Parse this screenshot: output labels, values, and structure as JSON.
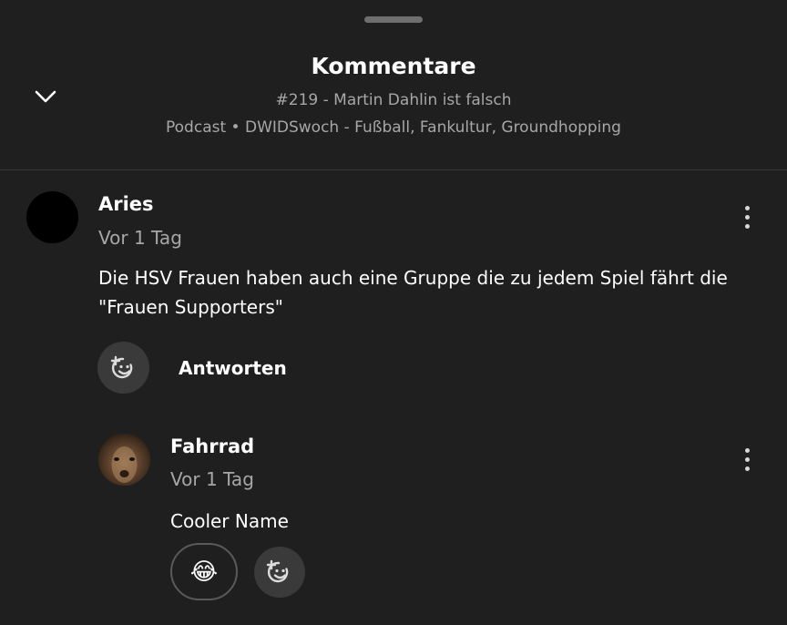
{
  "header": {
    "title": "Kommentare",
    "episode": "#219 - Martin Dahlin ist falsch",
    "show": "Podcast • DWIDSwoch - Fußball, Fankultur, Groundhopping"
  },
  "comments": [
    {
      "author": "Aries",
      "time": "Vor 1 Tag",
      "text_line1": "Die HSV Frauen haben auch eine Gruppe die zu jedem Spiel fährt die",
      "text_line2": "\"Frauen Supporters\"",
      "reply_label": "Antworten"
    },
    {
      "author": "Fahrrad",
      "time": "Vor 1 Tag",
      "text": "Cooler Name",
      "reaction_emoji": "😂"
    }
  ],
  "icons": {
    "collapse": "chevron-down-icon",
    "more": "more-vertical-icon",
    "add_reaction": "add-reaction-icon"
  },
  "colors": {
    "background": "#1f1f1f",
    "secondary_text": "#a7a7a7",
    "button_bg": "#3a3a3a"
  }
}
